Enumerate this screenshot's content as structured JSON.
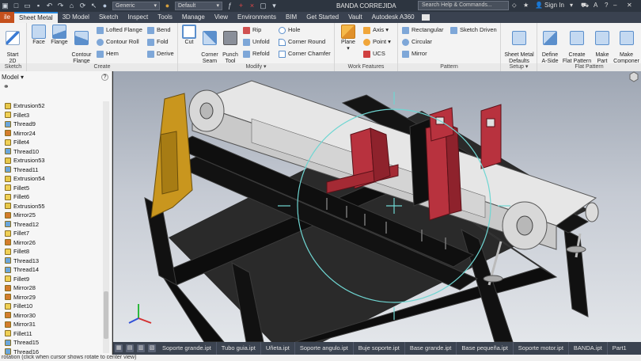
{
  "titlebar": {
    "material_combo": "Generic",
    "appearance_combo": "Default",
    "doc_title": "BANDA CORREJIDA",
    "help_search_placeholder": "Search Help & Commands...",
    "sign_in": "Sign In"
  },
  "tabs": [
    "ile",
    "Sheet Metal",
    "3D Model",
    "Sketch",
    "Inspect",
    "Tools",
    "Manage",
    "View",
    "Environments",
    "BIM",
    "Get Started",
    "Vault",
    "Autodesk A360"
  ],
  "ribbon": {
    "sketch_panel": {
      "title": "Sketch",
      "start_sketch": "Start\n2D Sketch"
    },
    "create_panel": {
      "title": "Create",
      "face": "Face",
      "flange": "Flange",
      "contour_flange": "Contour\nFlange",
      "lofted_flange": "Lofted Flange",
      "contour_roll": "Contour Roll",
      "hem": "Hem",
      "bend": "Bend",
      "fold": "Fold",
      "derive": "Derive"
    },
    "modify_panel": {
      "title": "Modify ▾",
      "cut": "Cut",
      "corner_seam": "Corner\nSeam",
      "punch_tool": "Punch\nTool",
      "rip": "Rip",
      "unfold": "Unfold",
      "refold": "Refold",
      "hole": "Hole",
      "corner_round": "Corner Round",
      "corner_chamfer": "Corner Chamfer"
    },
    "work_features_panel": {
      "title": "Work Features",
      "plane": "Plane",
      "axis": "Axis ▾",
      "point": "Point ▾",
      "ucs": "UCS"
    },
    "pattern_panel": {
      "title": "Pattern",
      "rectangular": "Rectangular",
      "circular": "Circular",
      "mirror": "Mirror",
      "sketch_driven": "Sketch Driven"
    },
    "setup_panel": {
      "title": "Setup ▾",
      "sheet_metal_defaults": "Sheet Metal\nDefaults"
    },
    "flat_pattern_panel": {
      "title": "Flat Pattern",
      "define_a_side": "Define\nA-Side",
      "create_flat_pattern": "Create\nFlat Pattern",
      "make_part": "Make\nPart",
      "make_components": "Make\nComponer"
    }
  },
  "browser": {
    "header": "Model ▾",
    "items": [
      {
        "label": "Extrusion52",
        "type": "extrude"
      },
      {
        "label": "Fillet3",
        "type": "fillet"
      },
      {
        "label": "Thread9",
        "type": "thread"
      },
      {
        "label": "Mirror24",
        "type": "mirror"
      },
      {
        "label": "Fillet4",
        "type": "fillet"
      },
      {
        "label": "Thread10",
        "type": "thread"
      },
      {
        "label": "Extrusion53",
        "type": "extrude"
      },
      {
        "label": "Thread11",
        "type": "thread"
      },
      {
        "label": "Extrusion54",
        "type": "extrude"
      },
      {
        "label": "Fillet5",
        "type": "fillet"
      },
      {
        "label": "Fillet6",
        "type": "fillet"
      },
      {
        "label": "Extrusion55",
        "type": "extrude"
      },
      {
        "label": "Mirror25",
        "type": "mirror"
      },
      {
        "label": "Thread12",
        "type": "thread"
      },
      {
        "label": "Fillet7",
        "type": "fillet"
      },
      {
        "label": "Mirror26",
        "type": "mirror"
      },
      {
        "label": "Fillet8",
        "type": "fillet"
      },
      {
        "label": "Thread13",
        "type": "thread"
      },
      {
        "label": "Thread14",
        "type": "thread"
      },
      {
        "label": "Fillet9",
        "type": "fillet"
      },
      {
        "label": "Mirror28",
        "type": "mirror"
      },
      {
        "label": "Mirror29",
        "type": "mirror"
      },
      {
        "label": "Fillet10",
        "type": "fillet"
      },
      {
        "label": "Mirror30",
        "type": "mirror"
      },
      {
        "label": "Mirror31",
        "type": "mirror"
      },
      {
        "label": "Fillet11",
        "type": "fillet"
      },
      {
        "label": "Thread15",
        "type": "thread"
      },
      {
        "label": "Thread16",
        "type": "thread"
      }
    ]
  },
  "doc_tabs": [
    "Soporte grande.ipt",
    "Tubo guia.ipt",
    "Uñeta.ipt",
    "Soporte angulo.ipt",
    "Buje soporte.ipt",
    "Base grande.ipt",
    "Base pequeña.ipt",
    "Soporte motor.ipt",
    "BANDA.ipt",
    "Part1"
  ],
  "status_text": "rotation (click when cursor shows rotate to center view)",
  "colors": {
    "accent_file_tab": "#c5501c",
    "frame": "#0e0e0e",
    "support_red": "#b8323e",
    "motor_plate": "#c9961e",
    "belt": "#dcdcdc",
    "rotate_circle": "#6fd6d2"
  },
  "icons": {
    "extrude": "extrude-icon",
    "fillet": "fillet-icon",
    "thread": "thread-icon",
    "mirror": "mirror-icon"
  }
}
